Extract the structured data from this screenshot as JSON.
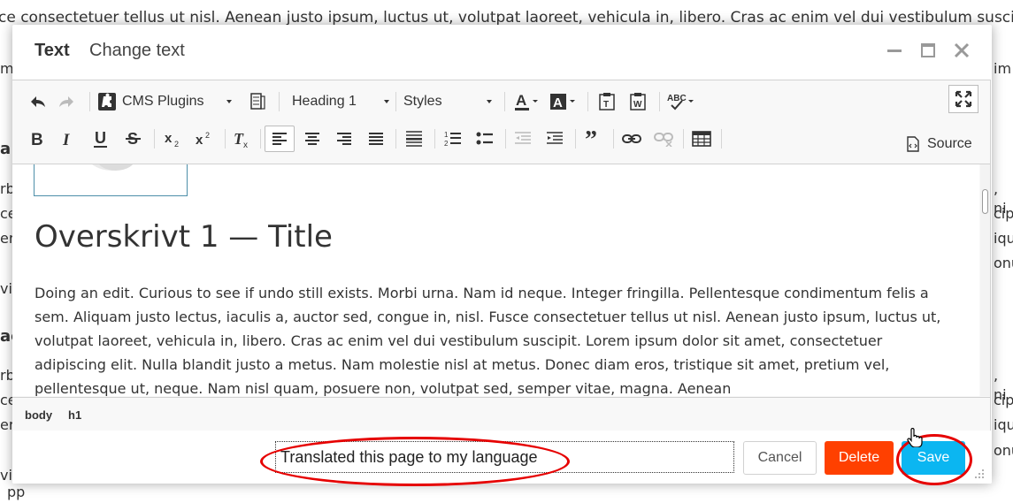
{
  "background": {
    "line_top": "ce consectetuer tellus ut nisl. Aenean justo ipsum, luctus ut, volutpat laoreet, vehicula in, libero. Cras ac enim vel dui vestibulum suscip",
    "line_bottom": "pp",
    "left_fragments": [
      "m",
      "a",
      "rb",
      "ce",
      "er",
      "vi",
      "ac",
      "rb",
      "ce",
      "er",
      "vi"
    ],
    "right_fragments": [
      "im",
      ", ni",
      "cip",
      "iqu",
      "onu",
      ", ni",
      "cip",
      "iqu",
      "onu"
    ]
  },
  "dialog": {
    "title": "Text",
    "subtitle": "Change text"
  },
  "toolbar": {
    "cms_plugins": "CMS Plugins",
    "format_value": "Heading 1",
    "styles_value": "Styles",
    "source_label": "Source"
  },
  "content": {
    "heading": "Overskrivt 1 — Title",
    "paragraph": "Doing an edit. Curious to see if undo still exists. Morbi urna. Nam id neque. Integer fringilla. Pellentesque condimentum felis a sem. Aliquam justo lectus, iaculis a, auctor sed, congue in, nisl. Fusce consectetuer tellus ut nisl. Aenean justo ipsum, luctus ut, volutpat laoreet, vehicula in, libero. Cras ac enim vel dui vestibulum suscipit. Lorem ipsum dolor sit amet, consectetuer adipiscing elit. Nulla blandit justo a metus. Nam molestie nisl at metus. Donec diam eros, tristique sit amet, pretium vel, pellentesque ut, neque. Nam nisl quam, posuere non, volutpat sed, semper vitae, magna. Aenean"
  },
  "elements_path": [
    "body",
    "h1"
  ],
  "footer": {
    "commit_message": "Translated this page to my language",
    "cancel_label": "Cancel",
    "delete_label": "Delete",
    "save_label": "Save"
  },
  "colors": {
    "delete": "#ff4000",
    "save": "#0bb6f1",
    "annotation": "#e60000"
  }
}
